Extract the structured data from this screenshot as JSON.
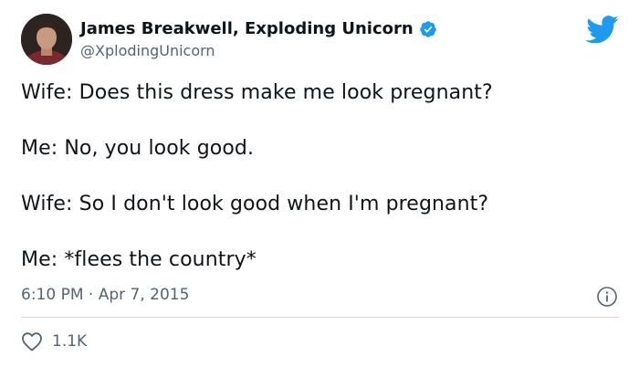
{
  "author": {
    "display_name": "James Breakwell, Exploding Unicorn",
    "handle": "@XplodingUnicorn",
    "verified_icon": "verified-badge-icon",
    "avatar_icon": "profile-photo"
  },
  "brand": {
    "logo_icon": "twitter-bird-icon",
    "accent_color": "#1d9bf0"
  },
  "tweet": {
    "lines": [
      "Wife: Does this dress make me look pregnant?",
      "Me: No, you look good.",
      "Wife: So I don't look good when I'm pregnant?",
      "Me: *flees the country*"
    ],
    "time": "6:10 PM",
    "separator": "·",
    "date": "Apr 7, 2015"
  },
  "actions": {
    "info_icon": "info-icon",
    "like_icon": "heart-icon",
    "like_count": "1.1K"
  }
}
